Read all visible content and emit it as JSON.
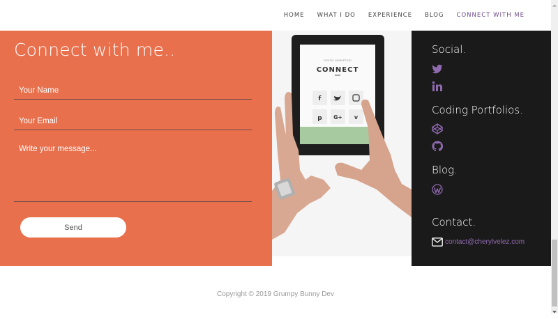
{
  "nav": {
    "items": [
      {
        "label": "HOME"
      },
      {
        "label": "WHAT I DO"
      },
      {
        "label": "EXPERIENCE"
      },
      {
        "label": "BLOG"
      },
      {
        "label": "CONNECT WITH ME",
        "active": true
      }
    ]
  },
  "form": {
    "title": "Connect with me..",
    "name_placeholder": "Your Name",
    "email_placeholder": "Your Email",
    "message_placeholder": "Write your message...",
    "send_label": "Send"
  },
  "photo": {
    "tablet_small_text": "DIGITAL MARKETING",
    "tablet_heading": "CONNECT"
  },
  "social": {
    "social_heading": "Social.",
    "coding_heading": "Coding Portfolios.",
    "blog_heading": "Blog.",
    "contact_heading": "Contact.",
    "email": "contact@cherylvelez.com",
    "icons": [
      "twitter-icon",
      "linkedin-icon",
      "codepen-icon",
      "github-icon",
      "wordpress-icon",
      "envelope-icon"
    ]
  },
  "footer": {
    "copyright": "Copyright © 2019 Grumpy Bunny Dev"
  },
  "colors": {
    "form_bg": "#e8704d",
    "social_bg": "#1b1a1a",
    "accent_purple": "#8f6aaf",
    "nav_active": "#6e4a8a"
  }
}
